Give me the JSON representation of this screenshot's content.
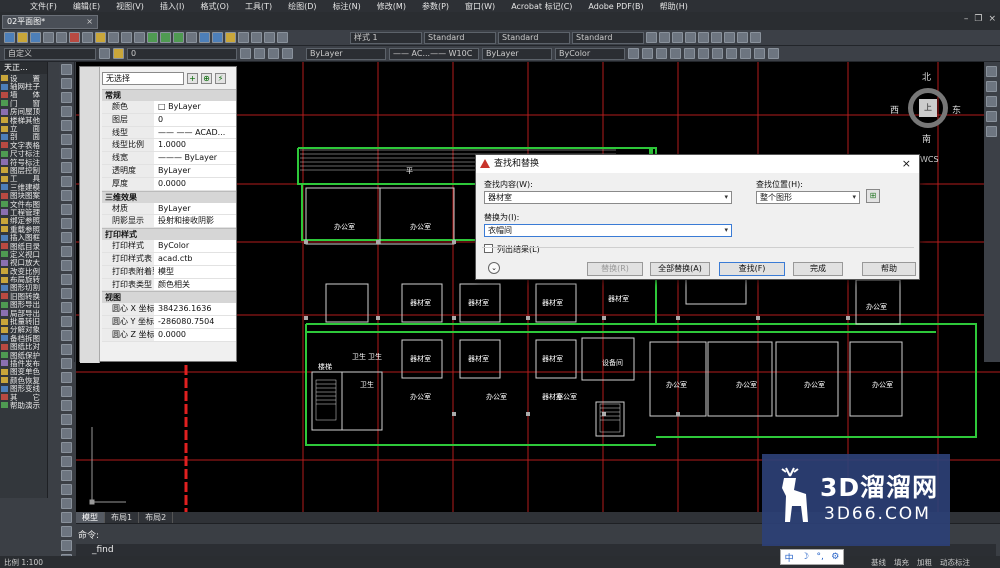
{
  "menu": [
    "文件(F)",
    "编辑(E)",
    "视图(V)",
    "插入(I)",
    "格式(O)",
    "工具(T)",
    "绘图(D)",
    "标注(N)",
    "修改(M)",
    "参数(P)",
    "窗口(W)",
    "Acrobat 标记(C)",
    "Adobe PDF(B)",
    "帮助(H)"
  ],
  "document_tab": "02平面图*",
  "toolbar": {
    "text_style": "样式 1",
    "dim_style": "Standard",
    "table_style": "Standard",
    "mleader_style": "Standard",
    "workspace": "自定义",
    "layer": "0",
    "color": "ByLayer",
    "linetype": "—— AC...—— W10C",
    "lineweight": "ByLayer",
    "plotstyle": "ByColor"
  },
  "left_panel": {
    "title": "天正...",
    "items": [
      "设　　置",
      "轴网柱子",
      "墙　　体",
      "门　　窗",
      "房间屋顶",
      "楼梯其他",
      "立　　面",
      "剖　　面",
      "文字表格",
      "尺寸标注",
      "符号标注",
      "图层控制",
      "工　　具",
      "三维建模",
      "图块图案",
      "文件布图",
      "工程管理",
      "绑定参照",
      "重载参照",
      "插入图框",
      "图纸目录",
      "定义视口",
      "视口放大",
      "改变比例",
      "布局旋转",
      "图形切割",
      "旧图转换",
      "图形导出",
      "局部导出",
      "批量转旧",
      "分解对象",
      "备档拆图",
      "图纸比对",
      "图纸保护",
      "插件发布",
      "图变单色",
      "颜色恢复",
      "图形变线",
      "其　　它",
      "帮助演示"
    ]
  },
  "properties": {
    "selection": "无选择",
    "sections": [
      {
        "title": "常规",
        "rows": [
          {
            "k": "颜色",
            "v": "□ ByLayer"
          },
          {
            "k": "图层",
            "v": "0"
          },
          {
            "k": "线型",
            "v": "—— —— ACAD..."
          },
          {
            "k": "线型比例",
            "v": "1.0000"
          },
          {
            "k": "线宽",
            "v": "——— ByLayer"
          },
          {
            "k": "透明度",
            "v": "ByLayer"
          },
          {
            "k": "厚度",
            "v": "0.0000"
          }
        ]
      },
      {
        "title": "三维效果",
        "rows": [
          {
            "k": "材质",
            "v": "ByLayer"
          },
          {
            "k": "阴影显示",
            "v": "投射和接收阴影"
          }
        ]
      },
      {
        "title": "打印样式",
        "rows": [
          {
            "k": "打印样式",
            "v": "ByColor"
          },
          {
            "k": "打印样式表",
            "v": "acad.ctb"
          },
          {
            "k": "打印表附着到",
            "v": "模型"
          },
          {
            "k": "打印表类型",
            "v": "颜色相关"
          }
        ]
      },
      {
        "title": "视图",
        "rows": [
          {
            "k": "圆心 X 坐标",
            "v": "384236.1636"
          },
          {
            "k": "圆心 Y 坐标",
            "v": "-286080.7504"
          },
          {
            "k": "圆心 Z 坐标",
            "v": "0.0000"
          }
        ]
      }
    ]
  },
  "dialog": {
    "title": "查找和替换",
    "find_label": "查找内容(W):",
    "find_value": "器材室",
    "where_label": "查找位置(H):",
    "where_value": "整个图形",
    "replace_label": "替换为(I):",
    "replace_value": "衣帽间",
    "list_results": "列出结果(L)",
    "btn_replace": "替换(R)",
    "btn_replace_all": "全部替换(A)",
    "btn_find": "查找(F)",
    "btn_done": "完成",
    "btn_help": "帮助"
  },
  "drawing_labels": {
    "top": "平台",
    "rooms_top": [
      "办公室",
      "办公室"
    ],
    "rooms_mid": [
      "器材室",
      "器材室",
      "器材室",
      "器材室",
      "器材储藏室"
    ],
    "rooms_low": [
      "器材室",
      "器材室",
      "器材室",
      "器材室",
      "设备间"
    ],
    "rooms_bottom": [
      "办公室",
      "办公室",
      "办公室",
      "办公室",
      "办公室",
      "办公室",
      "办公室"
    ],
    "small": [
      "卫生",
      "卫生",
      "卫生"
    ],
    "misc": [
      "楼梯",
      "办公室"
    ]
  },
  "compass": {
    "n": "北",
    "s": "南",
    "w": "西",
    "e": "东",
    "cube": "上",
    "wcs": "WCS"
  },
  "layout_tabs": [
    "模型",
    "布局1",
    "布局2"
  ],
  "command": {
    "label": "命令:",
    "input": "_find"
  },
  "status": {
    "scale": "比例 1:100",
    "right": [
      "基线",
      "填充",
      "加粗",
      "动态标注"
    ]
  },
  "watermark": {
    "big": "3D溜溜网",
    "small": "3D66.COM"
  },
  "ime": {
    "lang": "中"
  }
}
